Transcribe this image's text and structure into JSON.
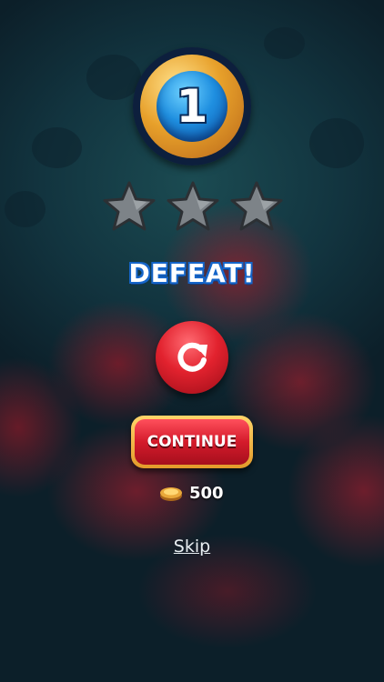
{
  "level": {
    "number": "1"
  },
  "stars": {
    "earned": 0,
    "total": 3
  },
  "result": {
    "title": "DEFEAT!"
  },
  "actions": {
    "retry_icon": "refresh-icon",
    "continue_label": "CONTINUE",
    "skip_label": "Skip"
  },
  "cost": {
    "icon": "coin-icon",
    "value": "500"
  },
  "colors": {
    "title_outline": "#1565c9",
    "button_red": "#d41b2b",
    "button_gold": "#e39b2a",
    "star_empty": "#8a8f93"
  }
}
